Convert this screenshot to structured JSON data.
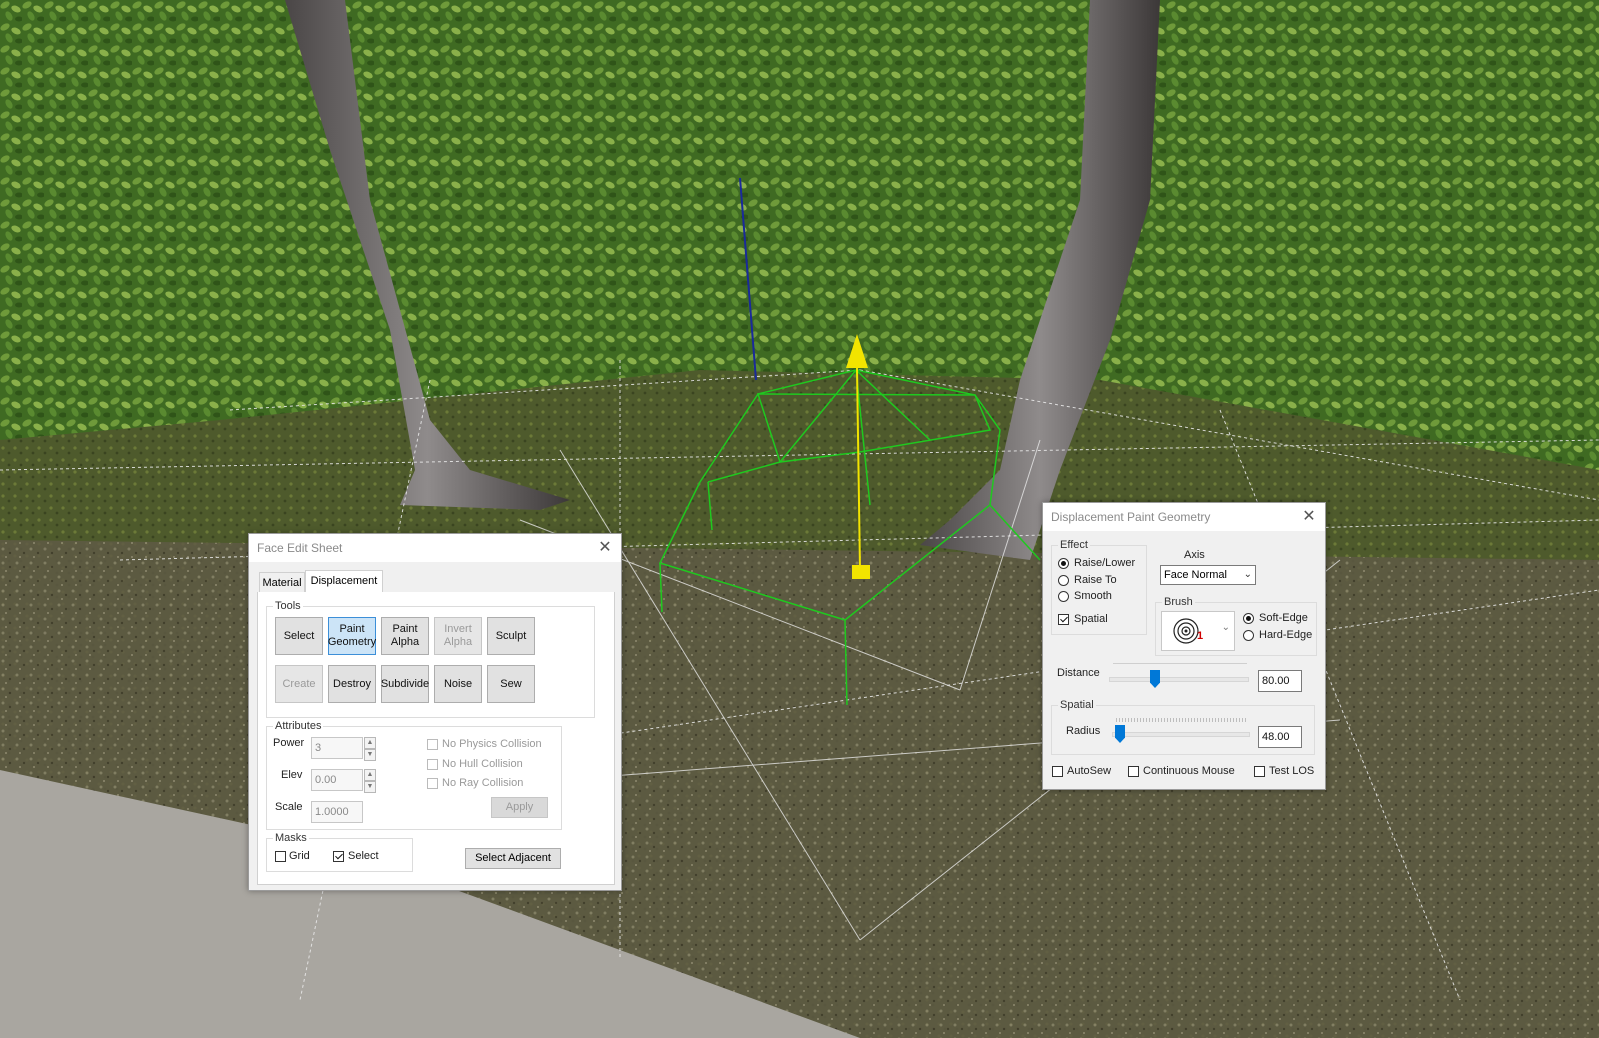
{
  "face_edit_sheet": {
    "title": "Face Edit Sheet",
    "tabs": [
      "Material",
      "Displacement"
    ],
    "active_tab": "Displacement",
    "tools": {
      "label": "Tools",
      "buttons": [
        "Select",
        "Paint\nGeometry",
        "Paint\nAlpha",
        "Invert\nAlpha",
        "Sculpt",
        "Create",
        "Destroy",
        "Subdivide",
        "Noise",
        "Sew"
      ],
      "active": "Paint\nGeometry",
      "disabled": [
        "Invert\nAlpha",
        "Create"
      ]
    },
    "attributes": {
      "label": "Attributes",
      "power_label": "Power",
      "power_value": "3",
      "elev_label": "Elev",
      "elev_value": "0.00",
      "scale_label": "Scale",
      "scale_value": "1.0000",
      "no_physics_collision": "No Physics Collision",
      "no_hull_collision": "No Hull Collision",
      "no_ray_collision": "No Ray Collision",
      "apply": "Apply"
    },
    "masks": {
      "label": "Masks",
      "grid": "Grid",
      "grid_checked": false,
      "select": "Select",
      "select_checked": true
    },
    "select_adjacent": "Select Adjacent"
  },
  "paint_geometry": {
    "title": "Displacement Paint Geometry",
    "effect": {
      "label": "Effect",
      "options": [
        "Raise/Lower",
        "Raise To",
        "Smooth"
      ],
      "selected": "Raise/Lower",
      "spatial": "Spatial",
      "spatial_checked": true
    },
    "axis": {
      "label": "Axis",
      "value": "Face Normal"
    },
    "brush": {
      "label": "Brush",
      "preview_number": "1",
      "soft_edge": "Soft-Edge",
      "hard_edge": "Hard-Edge",
      "selected": "Soft-Edge"
    },
    "distance": {
      "label": "Distance",
      "value": "80.00",
      "slider_fraction": 0.3
    },
    "spatial": {
      "label": "Spatial",
      "radius_label": "Radius",
      "radius_value": "48.00",
      "slider_fraction": 0.05
    },
    "autosew": "AutoSew",
    "continuous_mouse": "Continuous Mouse",
    "test_los": "Test LOS"
  },
  "colors": {
    "hedge": "#4f7a2a",
    "ground": "#5a5a3c",
    "wireframe": "#1fc91f",
    "gizmo": "#f2e400",
    "accent": "#0078d7"
  }
}
